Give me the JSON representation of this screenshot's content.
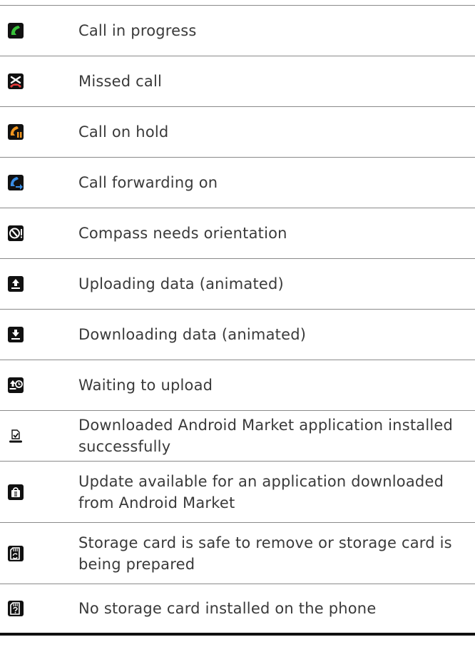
{
  "rows": [
    {
      "icon": "call-in-progress-icon",
      "text": "Call in progress"
    },
    {
      "icon": "missed-call-icon",
      "text": "Missed call"
    },
    {
      "icon": "call-on-hold-icon",
      "text": "Call on hold"
    },
    {
      "icon": "call-forwarding-icon",
      "text": "Call forwarding on"
    },
    {
      "icon": "compass-icon",
      "text": "Compass needs orientation"
    },
    {
      "icon": "upload-icon",
      "text": "Uploading data (animated)"
    },
    {
      "icon": "download-icon",
      "text": "Downloading data (animated)"
    },
    {
      "icon": "waiting-upload-icon",
      "text": "Waiting to upload"
    },
    {
      "icon": "market-installed-icon",
      "text": "Downloaded Android Market application installed successfully"
    },
    {
      "icon": "market-update-icon",
      "text": "Update available for an application downloaded from Android Market"
    },
    {
      "icon": "storage-card-safe-icon",
      "text": "Storage card is safe to remove or storage card is being prepared"
    },
    {
      "icon": "no-storage-card-icon",
      "text": "No storage card installed on the phone"
    }
  ]
}
